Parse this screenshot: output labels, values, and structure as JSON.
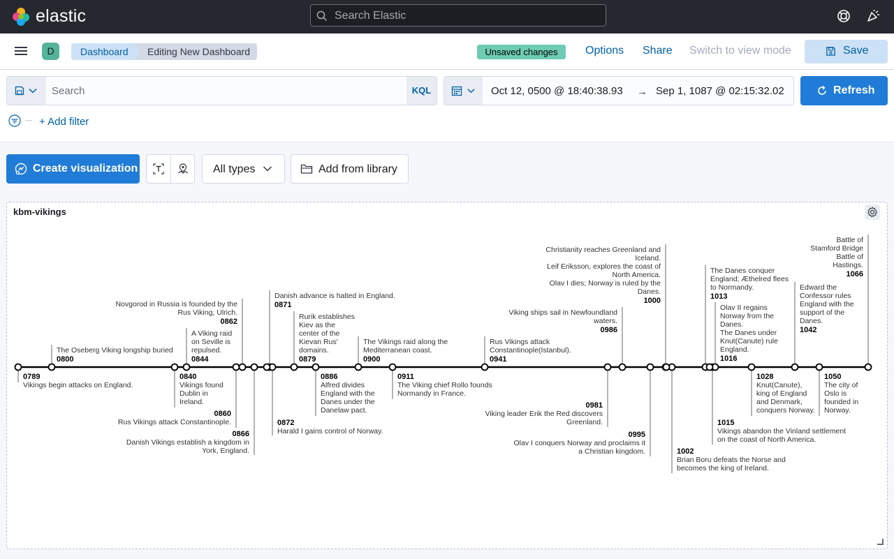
{
  "header": {
    "logo_text": "elastic",
    "search_placeholder": "Search Elastic",
    "icons": [
      "elastic-logo-icon",
      "search-icon",
      "help-icon",
      "newsfeed-icon"
    ]
  },
  "nav": {
    "avatar": "D",
    "breadcrumbs": [
      "Dashboard",
      "Editing New Dashboard"
    ],
    "unsaved_badge": "Unsaved changes",
    "options": "Options",
    "share": "Share",
    "switch_mode": "Switch to view mode",
    "save": "Save"
  },
  "query": {
    "placeholder": "Search",
    "language": "KQL",
    "date_start": "Oct 12, 0500 @ 18:40:38.93",
    "date_arrow": "→",
    "date_end": "Sep 1, 1087 @ 02:15:32.02",
    "refresh": "Refresh",
    "add_filter": "+ Add filter"
  },
  "toolbar": {
    "create": "Create visualization",
    "all_types": "All types",
    "add_library": "Add from library"
  },
  "panel": {
    "title": "kbm-vikings"
  },
  "timeline": {
    "events": [
      {
        "year": "0789",
        "lines": [
          "Vikings begin attacks on England."
        ]
      },
      {
        "year": "0800",
        "lines": [
          "The Oseberg Viking longship buried"
        ]
      },
      {
        "year": "0840",
        "lines": [
          "Vikings found",
          "Dublin in",
          "Ireland."
        ]
      },
      {
        "year": "0844",
        "lines": [
          "A Viking raid",
          "on Seville is",
          "repulsed."
        ]
      },
      {
        "year": "0860",
        "lines": [
          "Rus Vikings attack Constantinople."
        ]
      },
      {
        "year": "0862",
        "lines": [
          "Novgorod in Russia is founded by the",
          "Rus Viking, Ulrich."
        ]
      },
      {
        "year": "0866",
        "lines": [
          "Danish Vikings establish a kingdom in",
          "York, England."
        ]
      },
      {
        "year": "0871",
        "lines": [
          "Danish advance is halted in England."
        ]
      },
      {
        "year": "0872",
        "lines": [
          "Harald I gains control of Norway."
        ]
      },
      {
        "year": "0879",
        "lines": [
          "Rurik establishes",
          "Kiev as the",
          "center of the",
          "Kievan Rus'",
          "domains."
        ]
      },
      {
        "year": "0886",
        "lines": [
          "Alfred divides",
          "England with the",
          "Danes under the",
          "Danelaw pact."
        ]
      },
      {
        "year": "0900",
        "lines": [
          "The Vikings raid along the",
          "Mediterranean coast."
        ]
      },
      {
        "year": "0911",
        "lines": [
          "The Viking chief Rollo founds",
          "Normandy in France."
        ]
      },
      {
        "year": "0941",
        "lines": [
          "Rus Vikings attack",
          "Constantinople(Istanbul)."
        ]
      },
      {
        "year": "0981",
        "lines": [
          "Viking leader Erik the Red discovers",
          "Greenland."
        ]
      },
      {
        "year": "0986",
        "lines": [
          "Viking ships sail in Newfoundland",
          "waters."
        ]
      },
      {
        "year": "0995",
        "lines": [
          "Olav I conquers Norway and proclaims it",
          "a Christian kingdom."
        ]
      },
      {
        "year": "1000",
        "lines": [
          "Christianity reaches Greenland and",
          "Iceland.",
          "Leif Eriksson, explores the coast of",
          "North America.",
          "Olav I dies; Norway is ruled by the",
          "Danes."
        ]
      },
      {
        "year": "1002",
        "lines": [
          "Brian Boru defeats the Norse and",
          "becomes the king of Ireland."
        ]
      },
      {
        "year": "1013",
        "lines": [
          "The Danes conquer",
          "England; Æthelred flees",
          "to Normandy."
        ]
      },
      {
        "year": "1015",
        "lines": [
          "Vikings abandon the Vinland settlement",
          "on the coast of North America."
        ]
      },
      {
        "year": "1016",
        "lines": [
          "Olav II regains",
          "Norway from the",
          "Danes.",
          "The Danes under",
          "Knut(Canute) rule",
          "England."
        ]
      },
      {
        "year": "1028",
        "lines": [
          "Knut(Canute),",
          "king of England",
          "and Denmark,",
          "conquers Norway."
        ]
      },
      {
        "year": "1042",
        "lines": [
          "Edward the",
          "Confessor rules",
          "England with the",
          "support of the",
          "Danes."
        ]
      },
      {
        "year": "1050",
        "lines": [
          "The city of",
          "Oslo is",
          "founded in",
          "Norway."
        ]
      },
      {
        "year": "1066",
        "lines": [
          "Battle of",
          "Stamford Bridge",
          "Battle of",
          "Hastings."
        ]
      }
    ]
  }
}
